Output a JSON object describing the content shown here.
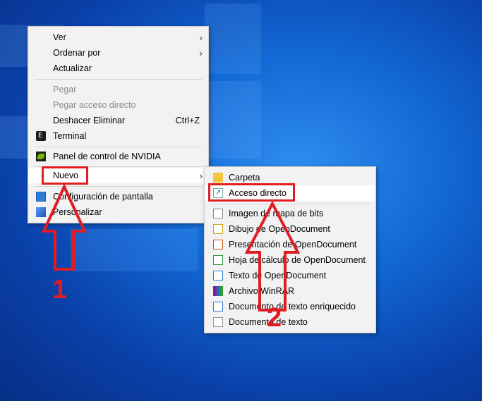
{
  "context_menu": {
    "items": [
      {
        "label": "Ver"
      },
      {
        "label": "Ordenar por"
      },
      {
        "label": "Actualizar"
      },
      {
        "label": "Pegar"
      },
      {
        "label": "Pegar acceso directo"
      },
      {
        "label": "Deshacer Eliminar",
        "shortcut": "Ctrl+Z"
      },
      {
        "label": "Terminal",
        "icon": "terminal-icon"
      },
      {
        "label": "Panel de control de NVIDIA",
        "icon": "nvidia-icon"
      },
      {
        "label": "Nuevo"
      },
      {
        "label": "Configuración de pantalla",
        "icon": "display-icon"
      },
      {
        "label": "Personalizar",
        "icon": "personalize-icon"
      }
    ]
  },
  "submenu": {
    "items": [
      {
        "label": "Carpeta",
        "icon": "folder-icon"
      },
      {
        "label": "Acceso directo",
        "icon": "shortcut-icon"
      },
      {
        "label": "Imagen de mapa de bits",
        "icon": "bitmap-icon"
      },
      {
        "label": "Dibujo de OpenDocument",
        "icon": "drawing-icon"
      },
      {
        "label": "Presentación de OpenDocument",
        "icon": "presentation-icon"
      },
      {
        "label": "Hoja de cálculo de OpenDocument",
        "icon": "spreadsheet-icon"
      },
      {
        "label": "Texto de OpenDocument",
        "icon": "odt-icon"
      },
      {
        "label": "Archivo WinRAR",
        "icon": "winrar-icon"
      },
      {
        "label": "Documento de texto enriquecido",
        "icon": "rtf-icon"
      },
      {
        "label": "Documento de texto",
        "icon": "txt-icon"
      }
    ]
  },
  "annotations": {
    "step1": "1",
    "step2": "2"
  },
  "colors": {
    "annotation": "#e11d21",
    "menu_bg": "#f2f2f2",
    "highlight": "#ffffff"
  }
}
